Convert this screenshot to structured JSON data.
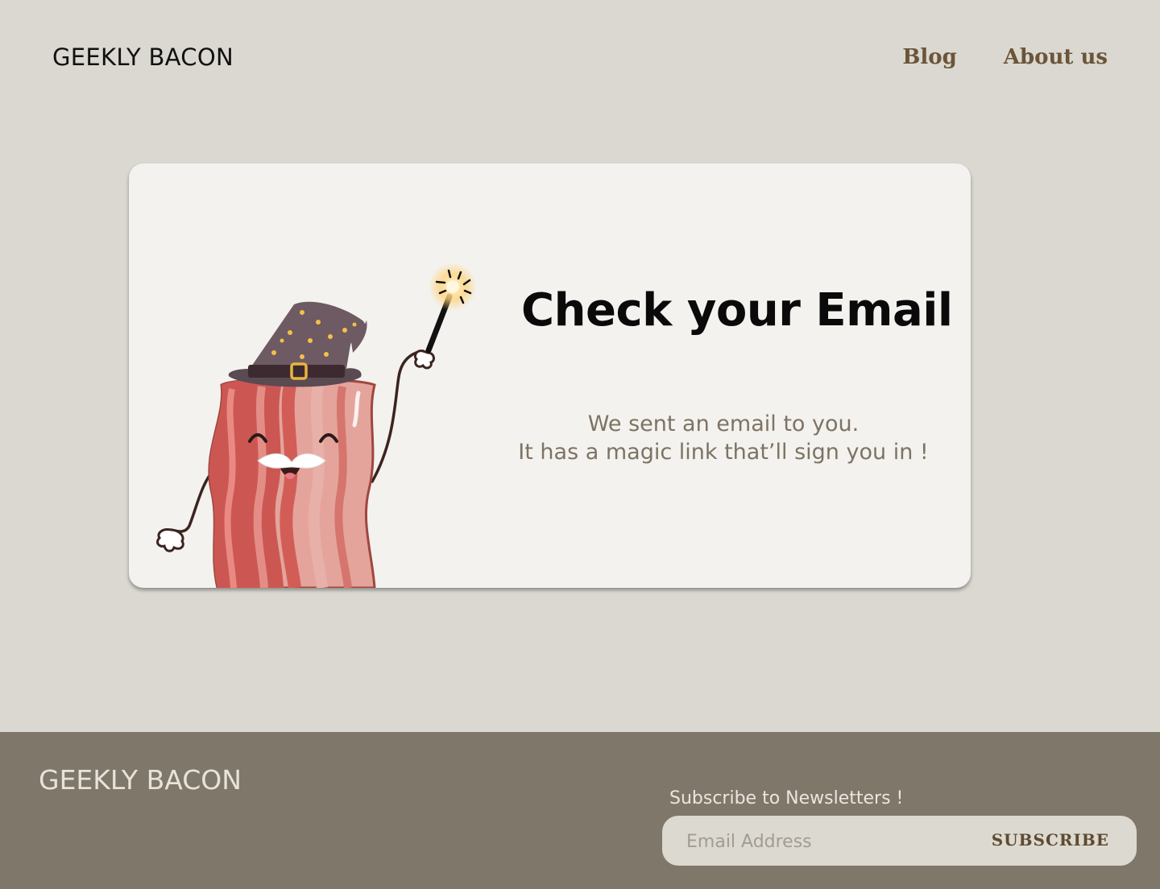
{
  "header": {
    "brand": "GEEKLY BACON",
    "nav": [
      {
        "label": "Blog"
      },
      {
        "label": "About us"
      }
    ]
  },
  "card": {
    "title": "Check your Email",
    "message_lines": [
      "We sent an email to you.",
      "It has a magic link that’ll sign you in !"
    ],
    "illustration": "wizard-bacon-mascot"
  },
  "footer": {
    "brand": "GEEKLY BACON",
    "subscribe_label": "Subscribe to Newsletters !",
    "email_placeholder": "Email Address",
    "subscribe_button": "SUBSCRIBE"
  },
  "colors": {
    "page_bg": "#dbd8d1",
    "card_bg": "#f3f2ee",
    "footer_bg": "#7e776a",
    "nav_text": "#6b5538",
    "message_text": "#7d7364"
  }
}
